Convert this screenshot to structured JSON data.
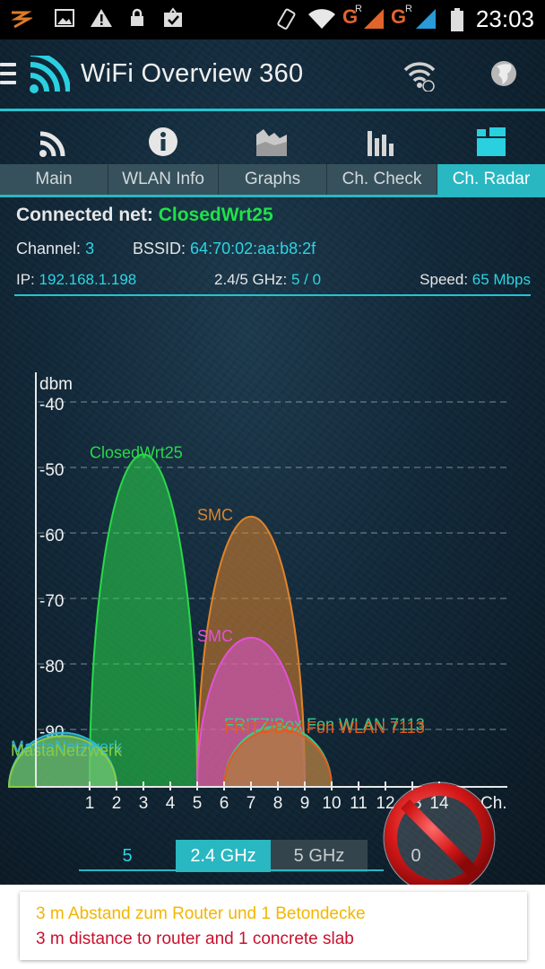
{
  "status_bar": {
    "time": "23:03",
    "network_type_1": "G",
    "network_type_2": "G",
    "roaming_1": "R",
    "roaming_2": "R",
    "colors": {
      "network": "#e0642c"
    }
  },
  "app": {
    "title": "WiFi Overview 360",
    "accent_color": "#26c3cf"
  },
  "tabs": [
    {
      "label": "Main",
      "icon": "wifi-signal-icon",
      "active": false
    },
    {
      "label": "WLAN Info",
      "icon": "info-icon",
      "active": false
    },
    {
      "label": "Graphs",
      "icon": "area-chart-icon",
      "active": false
    },
    {
      "label": "Ch. Check",
      "icon": "bar-chart-icon",
      "active": false
    },
    {
      "label": "Ch. Radar",
      "icon": "radar-icon",
      "active": true
    }
  ],
  "connection": {
    "connected_label": "Connected net:",
    "ssid": "ClosedWrt25",
    "channel_label": "Channel:",
    "channel": "3",
    "bssid_label": "BSSID:",
    "bssid": "64:70:02:aa:b8:2f",
    "ip_label": "IP:",
    "ip": "192.168.1.198",
    "band_label": "2.4/5 GHz:",
    "band": "5 / 0",
    "speed_label": "Speed:",
    "speed": "65 Mbps"
  },
  "chart_data": {
    "type": "area",
    "ylabel": "dbm",
    "xlabel": "Ch.",
    "y_ticks": [
      "-40",
      "-50",
      "-60",
      "-70",
      "-80",
      "-90"
    ],
    "ylim": [
      -96,
      -38
    ],
    "x_ticks": [
      "1",
      "2",
      "3",
      "4",
      "5",
      "6",
      "7",
      "8",
      "9",
      "10",
      "11",
      "12",
      "13",
      "14"
    ],
    "xlim": [
      -1,
      15
    ],
    "series": [
      {
        "name": "ClosedWrt25",
        "center": 3,
        "width": 4,
        "peak": -48,
        "color": "#2ad84a"
      },
      {
        "name": "SMC",
        "center": 7,
        "width": 4,
        "peak": -57.5,
        "color": "#e0832a"
      },
      {
        "name": "SMC",
        "center": 7,
        "width": 4,
        "peak": -76,
        "color": "#e052d8"
      },
      {
        "name": "FRITZ!Box Fon WLAN 7113",
        "center": 8,
        "width": 4,
        "peak": -89.5,
        "color": "#3ccc88"
      },
      {
        "name": "FRITZ!Box Fon WLAN 7113",
        "center": 8,
        "width": 4,
        "peak": -90,
        "color": "#e25a22"
      },
      {
        "name": "MastaNetzwerk",
        "center": 0,
        "width": 4,
        "peak": -90.5,
        "color": "#2fb8d4"
      },
      {
        "name": "MastaNetzwerk",
        "center": 0,
        "width": 4,
        "peak": -91,
        "color": "#88cc44"
      }
    ]
  },
  "band_tabs": {
    "count": "5",
    "ghz24": "2.4 GHz",
    "ghz5": "5 GHz",
    "count5": "0"
  },
  "caption": {
    "line_de": "3 m  Abstand zum Router und 1 Betondecke",
    "line_en": "3 m distance to router and 1 concrete slab"
  }
}
